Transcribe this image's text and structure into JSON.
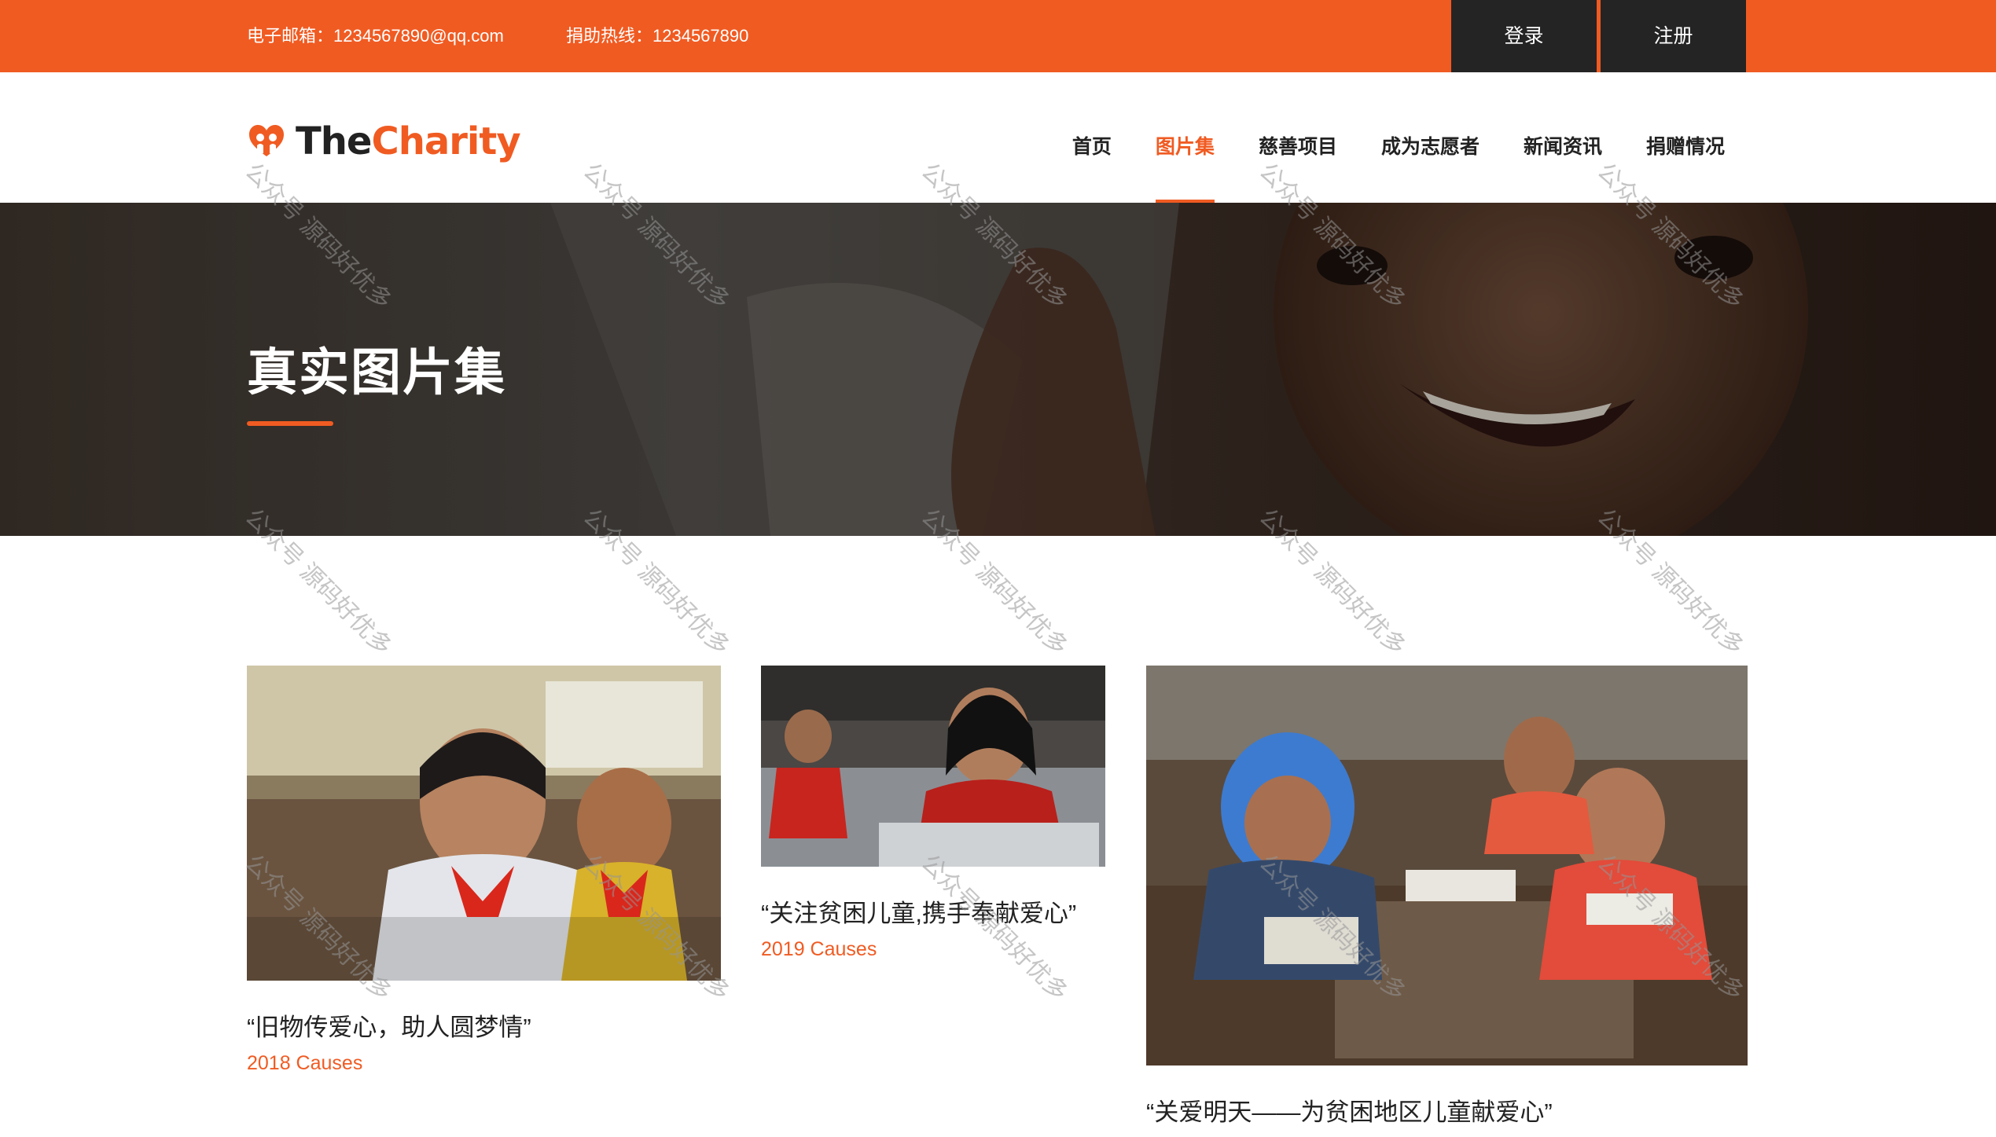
{
  "topbar": {
    "email": "电子邮箱：1234567890@qq.com",
    "hotline": "捐助热线：1234567890",
    "login": "登录",
    "register": "注册",
    "bg_color": "#f05b22",
    "button_color": "#242424"
  },
  "header": {
    "logo_the": "The",
    "logo_charity": "Charity",
    "nav": [
      {
        "label": "首页",
        "active": false
      },
      {
        "label": "图片集",
        "active": true
      },
      {
        "label": "慈善项目",
        "active": false
      },
      {
        "label": "成为志愿者",
        "active": false
      },
      {
        "label": "新闻资讯",
        "active": false
      },
      {
        "label": "捐赠情况",
        "active": false
      }
    ]
  },
  "hero": {
    "title": "真实图片集"
  },
  "gallery": [
    {
      "caption": "“旧物传爱心，助人圆梦情”",
      "sub": "2018 Causes"
    },
    {
      "caption": "“关注贫困儿童,携手奉献爱心”",
      "sub": "2019 Causes"
    },
    {
      "caption": "“关爱明天——为贫困地区儿童献爱心”",
      "sub": ""
    }
  ],
  "watermark": "公众号 源码好优多",
  "accent_color": "#f05b22"
}
